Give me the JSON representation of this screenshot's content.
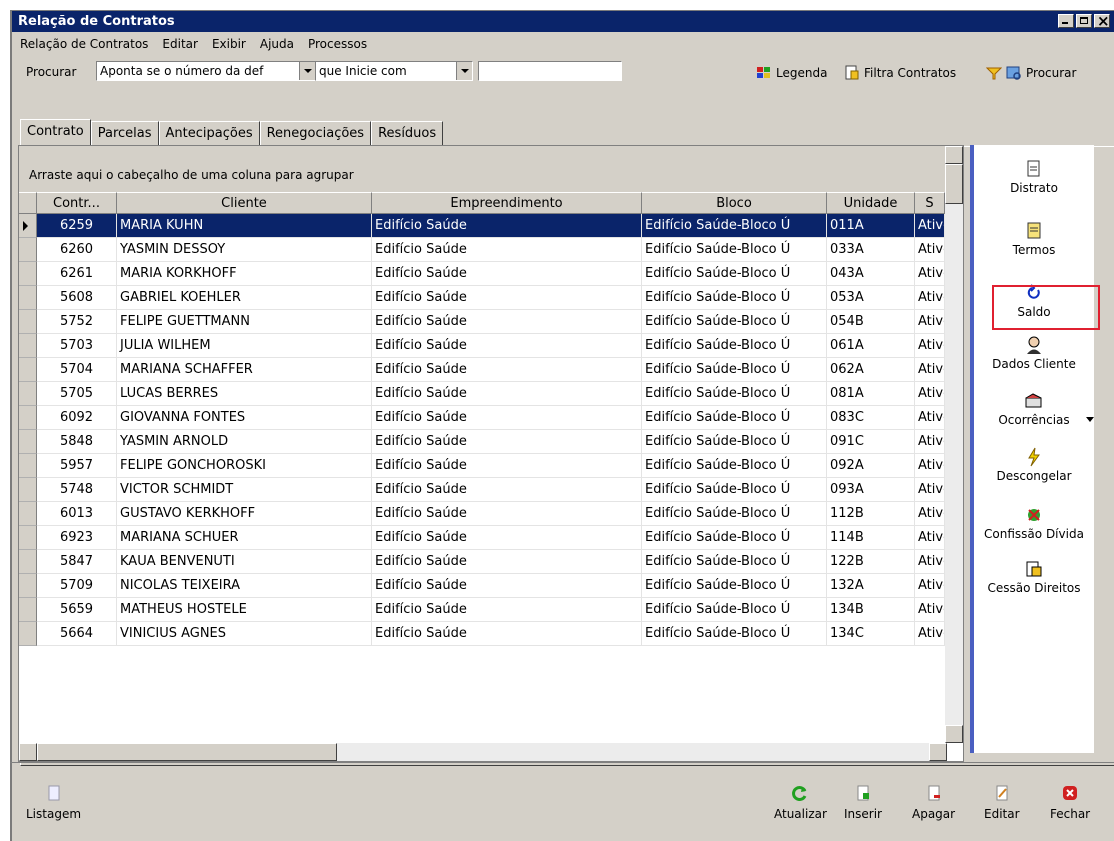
{
  "window": {
    "title": "Relação de Contratos"
  },
  "menu": [
    "Relação de Contratos",
    "Editar",
    "Exibir",
    "Ajuda",
    "Processos"
  ],
  "search": {
    "label": "Procurar",
    "field_value": "Aponta se o número da def",
    "operator_value": "que Inicie com",
    "text_value": ""
  },
  "toolbar": {
    "legend": "Legenda",
    "filter": "Filtra Contratos",
    "search": "Procurar"
  },
  "tabs": [
    "Contrato",
    "Parcelas",
    "Antecipações",
    "Renegociações",
    "Resíduos"
  ],
  "grid": {
    "group_hint": "Arraste aqui o cabeçalho de uma coluna para agrupar",
    "columns": [
      "Contr...",
      "Cliente",
      "Empreendimento",
      "Bloco",
      "Unidade",
      "S"
    ],
    "rows": [
      [
        "6259",
        "MARIA KUHN",
        "Edifício Saúde",
        "Edifício Saúde-Bloco Ú",
        "011A",
        "Ativo"
      ],
      [
        "6260",
        "YASMIN DESSOY",
        "Edifício Saúde",
        "Edifício Saúde-Bloco Ú",
        "033A",
        "Ativo"
      ],
      [
        "6261",
        "MARIA KORKHOFF",
        "Edifício Saúde",
        "Edifício Saúde-Bloco Ú",
        "043A",
        "Ativo"
      ],
      [
        "5608",
        "GABRIEL KOEHLER",
        "Edifício Saúde",
        "Edifício Saúde-Bloco Ú",
        "053A",
        "Ativo"
      ],
      [
        "5752",
        "FELIPE GUETTMANN",
        "Edifício Saúde",
        "Edifício Saúde-Bloco Ú",
        "054B",
        "Ativo"
      ],
      [
        "5703",
        "JULIA WILHEM",
        "Edifício Saúde",
        "Edifício Saúde-Bloco Ú",
        "061A",
        "Ativo"
      ],
      [
        "5704",
        "MARIANA SCHAFFER",
        "Edifício Saúde",
        "Edifício Saúde-Bloco Ú",
        "062A",
        "Ativo"
      ],
      [
        "5705",
        "LUCAS BERRES",
        "Edifício Saúde",
        "Edifício Saúde-Bloco Ú",
        "081A",
        "Ativo"
      ],
      [
        "6092",
        "GIOVANNA FONTES",
        "Edifício Saúde",
        "Edifício Saúde-Bloco Ú",
        "083C",
        "Ativo"
      ],
      [
        "5848",
        "YASMIN ARNOLD",
        "Edifício Saúde",
        "Edifício Saúde-Bloco Ú",
        "091C",
        "Ativo"
      ],
      [
        "5957",
        "FELIPE GONCHOROSKI",
        "Edifício Saúde",
        "Edifício Saúde-Bloco Ú",
        "092A",
        "Ativo"
      ],
      [
        "5748",
        "VICTOR SCHMIDT",
        "Edifício Saúde",
        "Edifício Saúde-Bloco Ú",
        "093A",
        "Ativo"
      ],
      [
        "6013",
        "GUSTAVO KERKHOFF",
        "Edifício Saúde",
        "Edifício Saúde-Bloco Ú",
        "112B",
        "Ativo"
      ],
      [
        "6923",
        "MARIANA SCHUER",
        "Edifício Saúde",
        "Edifício Saúde-Bloco Ú",
        "114B",
        "Ativo"
      ],
      [
        "5847",
        "KAUA BENVENUTI",
        "Edifício Saúde",
        "Edifício Saúde-Bloco Ú",
        "122B",
        "Ativo"
      ],
      [
        "5709",
        "NICOLAS TEIXEIRA",
        "Edifício Saúde",
        "Edifício Saúde-Bloco Ú",
        "132A",
        "Ativo"
      ],
      [
        "5659",
        "MATHEUS HOSTELE",
        "Edifício Saúde",
        "Edifício Saúde-Bloco Ú",
        "134B",
        "Ativo"
      ],
      [
        "5664",
        "VINICIUS AGNES",
        "Edifício Saúde",
        "Edifício Saúde-Bloco Ú",
        "134C",
        "Ativo"
      ]
    ]
  },
  "side_actions": [
    "Distrato",
    "Termos",
    "Saldo",
    "Dados Cliente",
    "Ocorrências",
    "Descongelar",
    "Confissão Dívida",
    "Cessão Direitos"
  ],
  "bottom_actions": {
    "list": "Listagem",
    "refresh": "Atualizar",
    "insert": "Inserir",
    "delete": "Apagar",
    "edit": "Editar",
    "close": "Fechar"
  },
  "colors": {
    "title_bar": "#0a246a",
    "selection": "#0a246a",
    "highlight_box": "#e02030",
    "side_border": "#4a5fc1"
  }
}
